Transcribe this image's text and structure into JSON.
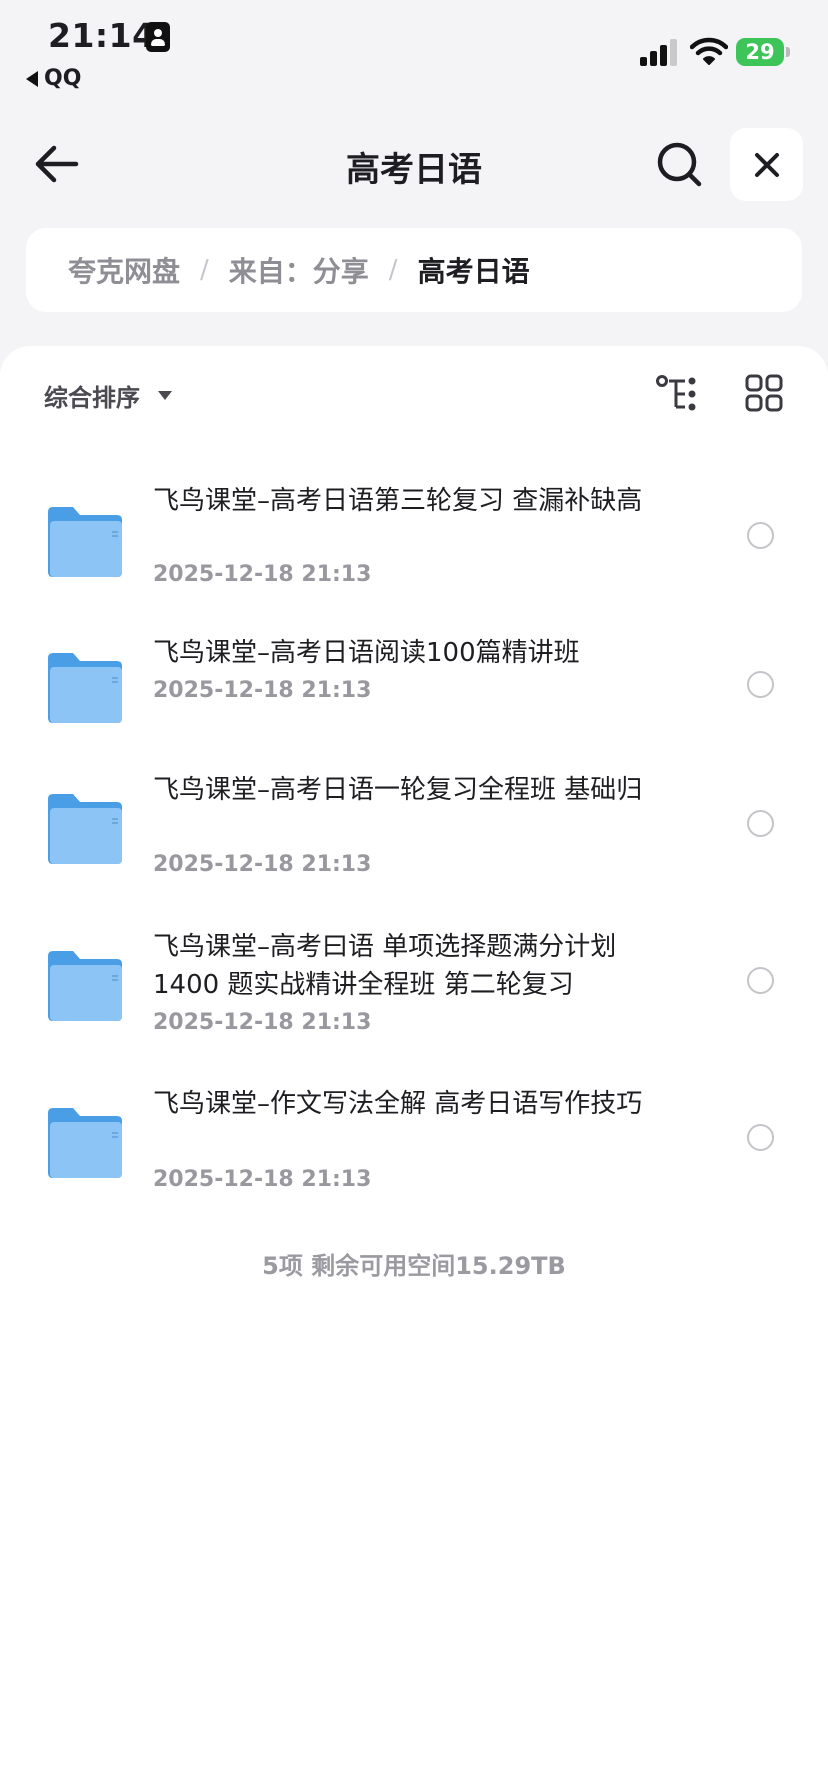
{
  "status_bar": {
    "time": "21:14",
    "back_app": "QQ",
    "battery": "29"
  },
  "nav": {
    "title": "高考日语"
  },
  "breadcrumb": {
    "items": [
      "夸克网盘",
      "来自：分享",
      "高考日语"
    ],
    "separator": "/"
  },
  "toolbar": {
    "sort_label": "综合排序"
  },
  "files": [
    {
      "name": "飞鸟课堂–高考日语第三轮复习 查漏补缺高",
      "date": "2025-12-18 21:13"
    },
    {
      "name": "飞鸟课堂–高考日语阅读100篇精讲班",
      "date": "2025-12-18 21:13"
    },
    {
      "name": "飞鸟课堂–高考日语一轮复习全程班 基础归",
      "date": "2025-12-18 21:13"
    },
    {
      "name": "飞鸟课堂–高考曰语 单项选择题满分计划1400 题实战精讲全程班 第二轮复习",
      "date": "2025-12-18 21:13"
    },
    {
      "name": "飞鸟课堂–作文写法全解 高考日语写作技巧",
      "date": "2025-12-18 21:13"
    }
  ],
  "summary": "5项 剩余可用空间15.29TB",
  "colors": {
    "folder": "#62aef0",
    "battery": "#3dc55a",
    "background": "#f4f4f6"
  }
}
